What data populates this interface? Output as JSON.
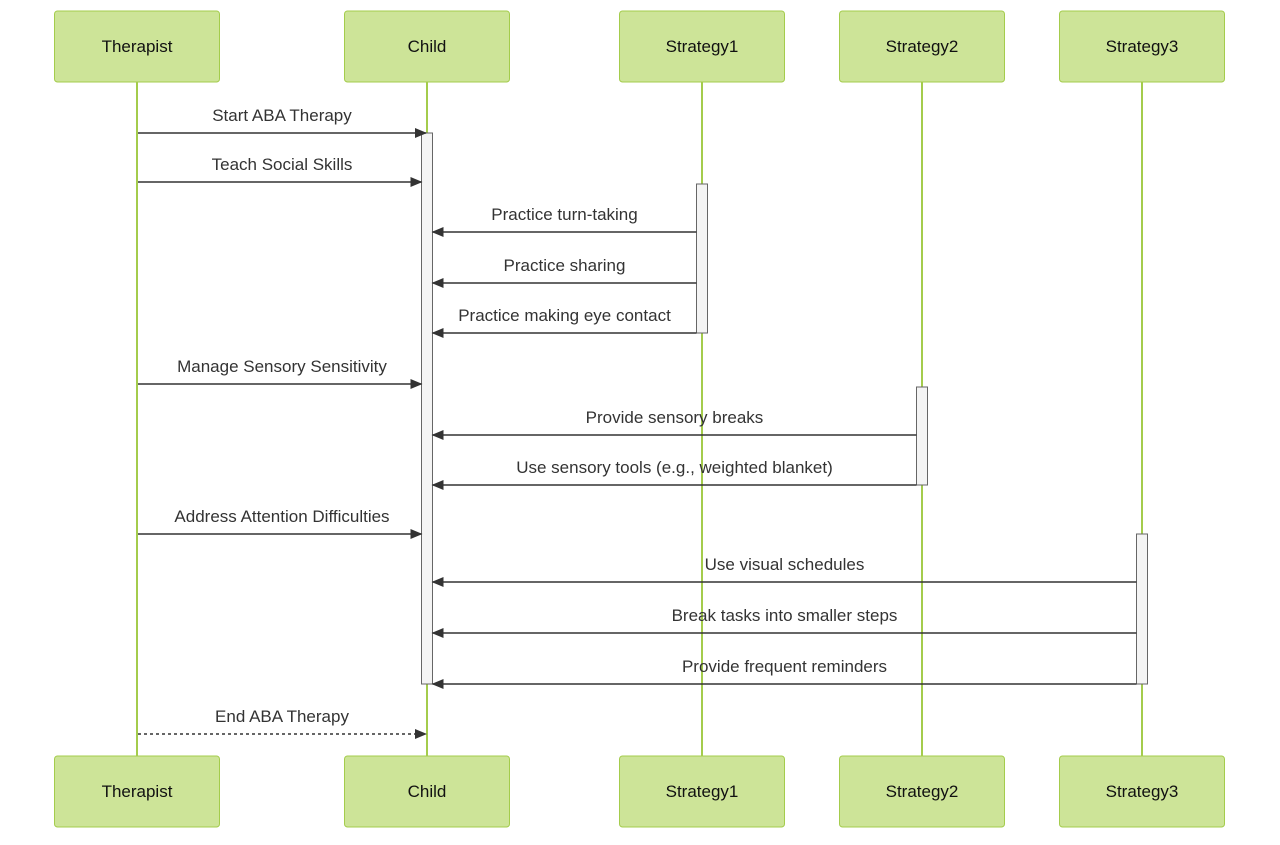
{
  "diagram": {
    "type": "sequence",
    "actors": [
      {
        "id": "Therapist",
        "label": "Therapist"
      },
      {
        "id": "Child",
        "label": "Child"
      },
      {
        "id": "Strategy1",
        "label": "Strategy1"
      },
      {
        "id": "Strategy2",
        "label": "Strategy2"
      },
      {
        "id": "Strategy3",
        "label": "Strategy3"
      }
    ],
    "messages": [
      {
        "from": "Therapist",
        "to": "Child",
        "label": "Start ABA Therapy",
        "style": "solid"
      },
      {
        "from": "Therapist",
        "to": "Child",
        "label": "Teach Social Skills",
        "style": "solid"
      },
      {
        "from": "Strategy1",
        "to": "Child",
        "label": "Practice turn-taking",
        "style": "solid"
      },
      {
        "from": "Strategy1",
        "to": "Child",
        "label": "Practice sharing",
        "style": "solid"
      },
      {
        "from": "Strategy1",
        "to": "Child",
        "label": "Practice making eye contact",
        "style": "solid"
      },
      {
        "from": "Therapist",
        "to": "Child",
        "label": "Manage Sensory Sensitivity",
        "style": "solid"
      },
      {
        "from": "Strategy2",
        "to": "Child",
        "label": "Provide sensory breaks",
        "style": "solid"
      },
      {
        "from": "Strategy2",
        "to": "Child",
        "label": "Use sensory tools (e.g., weighted blanket)",
        "style": "solid"
      },
      {
        "from": "Therapist",
        "to": "Child",
        "label": "Address Attention Difficulties",
        "style": "solid"
      },
      {
        "from": "Strategy3",
        "to": "Child",
        "label": "Use visual schedules",
        "style": "solid"
      },
      {
        "from": "Strategy3",
        "to": "Child",
        "label": "Break tasks into smaller steps",
        "style": "solid"
      },
      {
        "from": "Strategy3",
        "to": "Child",
        "label": "Provide frequent reminders",
        "style": "solid"
      },
      {
        "from": "Therapist",
        "to": "Child",
        "label": "End ABA Therapy",
        "style": "dashed"
      }
    ],
    "activations": [
      {
        "actor": "Child",
        "from_message": 0,
        "to_message": 11
      },
      {
        "actor": "Strategy1",
        "from_message": 2,
        "to_message": 4
      },
      {
        "actor": "Strategy2",
        "from_message": 6,
        "to_message": 7
      },
      {
        "actor": "Strategy3",
        "from_message": 9,
        "to_message": 11
      }
    ],
    "colors": {
      "actor_fill": "#cde498",
      "actor_border": "#a4cc4c",
      "lifeline": "#a4cc4c",
      "message": "#333333",
      "activation_fill": "#f4f4f4"
    }
  }
}
